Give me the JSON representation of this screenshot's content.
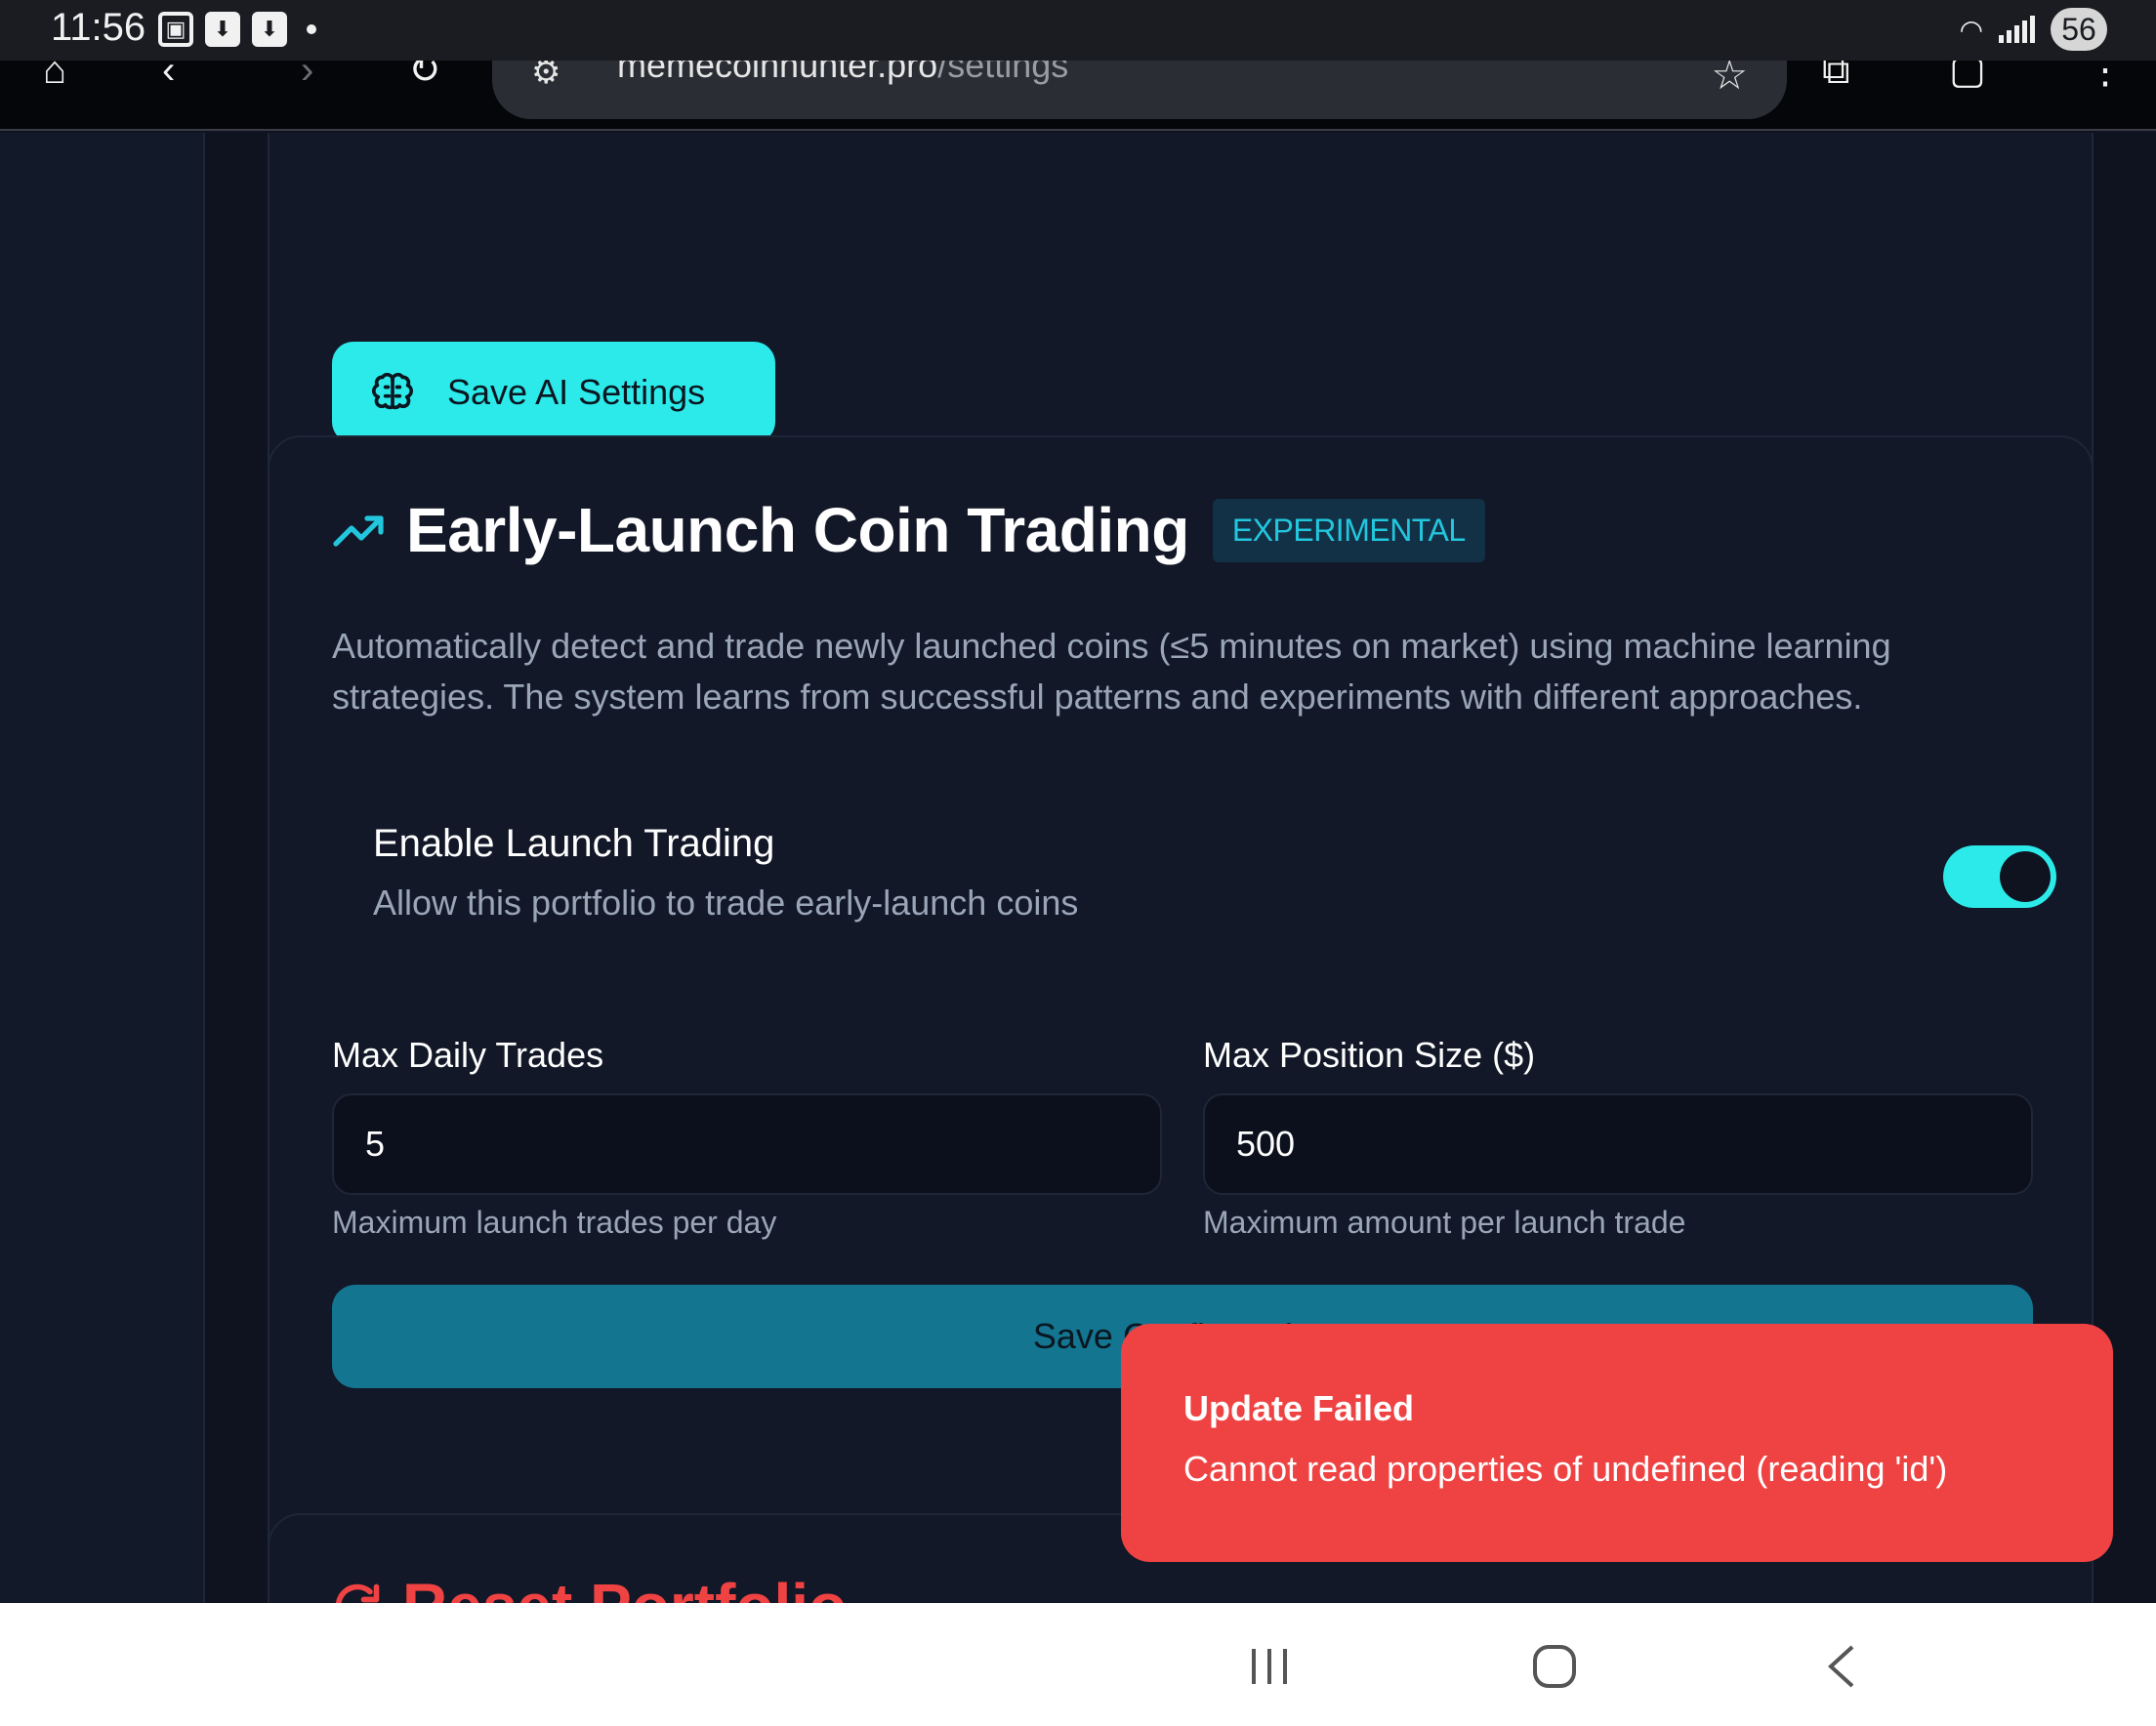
{
  "status_bar": {
    "time": "11:56",
    "battery": "56"
  },
  "browser": {
    "url_domain": "memecoinhunter.pro",
    "url_path": "/settings"
  },
  "ai_settings": {
    "save_label": "Save AI Settings"
  },
  "launch_section": {
    "title": "Early-Launch Coin Trading",
    "badge": "EXPERIMENTAL",
    "description": "Automatically detect and trade newly launched coins (≤5 minutes on market) using machine learning strategies. The system learns from successful patterns and experiments with different approaches.",
    "toggle_title": "Enable Launch Trading",
    "toggle_sub": "Allow this portfolio to trade early-launch coins",
    "toggle_on": true,
    "max_daily_trades": {
      "label": "Max Daily Trades",
      "value": "5",
      "help": "Maximum launch trades per day"
    },
    "max_position_size": {
      "label": "Max Position Size ($)",
      "value": "500",
      "help": "Maximum amount per launch trade"
    },
    "save_config_label": "Save Configuration"
  },
  "reset_section": {
    "title": "Reset Portfolio"
  },
  "toast": {
    "title": "Update Failed",
    "message": "Cannot read properties of undefined (reading 'id')"
  },
  "colors": {
    "accent": "#2ceaea",
    "badge_text": "#22c7de",
    "save_config_bg": "#137590",
    "danger": "#ef4343",
    "background": "#0f1320",
    "card": "#121827"
  }
}
